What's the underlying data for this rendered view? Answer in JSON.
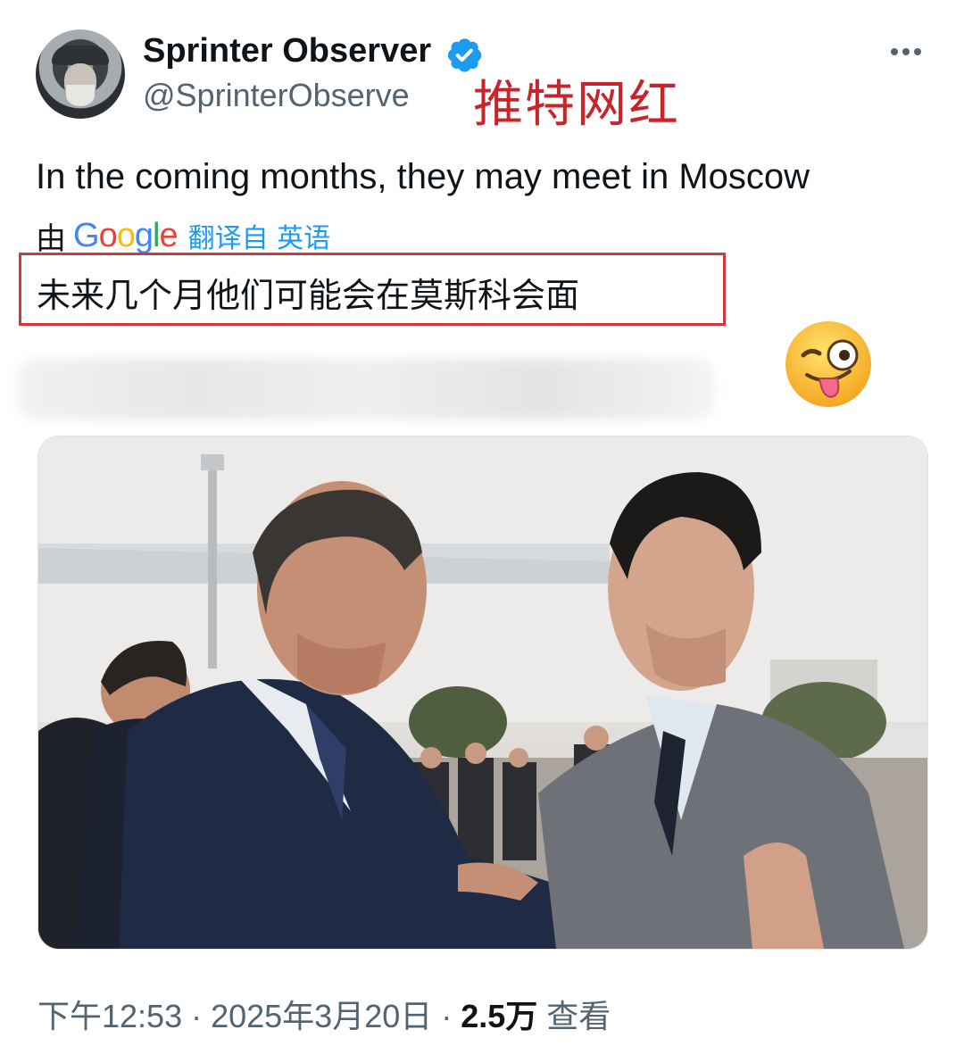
{
  "header": {
    "display_name": "Sprinter Observer",
    "handle": "@SprinterObserve",
    "overlay_label": "推特网红",
    "verified_icon": "verified-badge-icon",
    "more_icon": "more-options-icon"
  },
  "tweet": {
    "text": "In the coming months, they may meet in Moscow",
    "translation": {
      "by_prefix": "由",
      "provider": "Google",
      "translated_from": "翻译自 英语",
      "text": "未来几个月他们可能会在莫斯科会面"
    },
    "emoji_icon": "winking-face-with-tongue-icon",
    "media_description_icon": "photo-two-leaders-greeting"
  },
  "meta": {
    "time": "下午12:53",
    "separator_1": "·",
    "date": "2025年3月20日",
    "separator_2": "·",
    "views_count": "2.5万",
    "views_label": "查看"
  },
  "colors": {
    "verified_blue": "#1d9bf0",
    "overlay_red": "#c8242b",
    "highlight_border": "#d23a3a",
    "secondary_text": "#536471"
  }
}
